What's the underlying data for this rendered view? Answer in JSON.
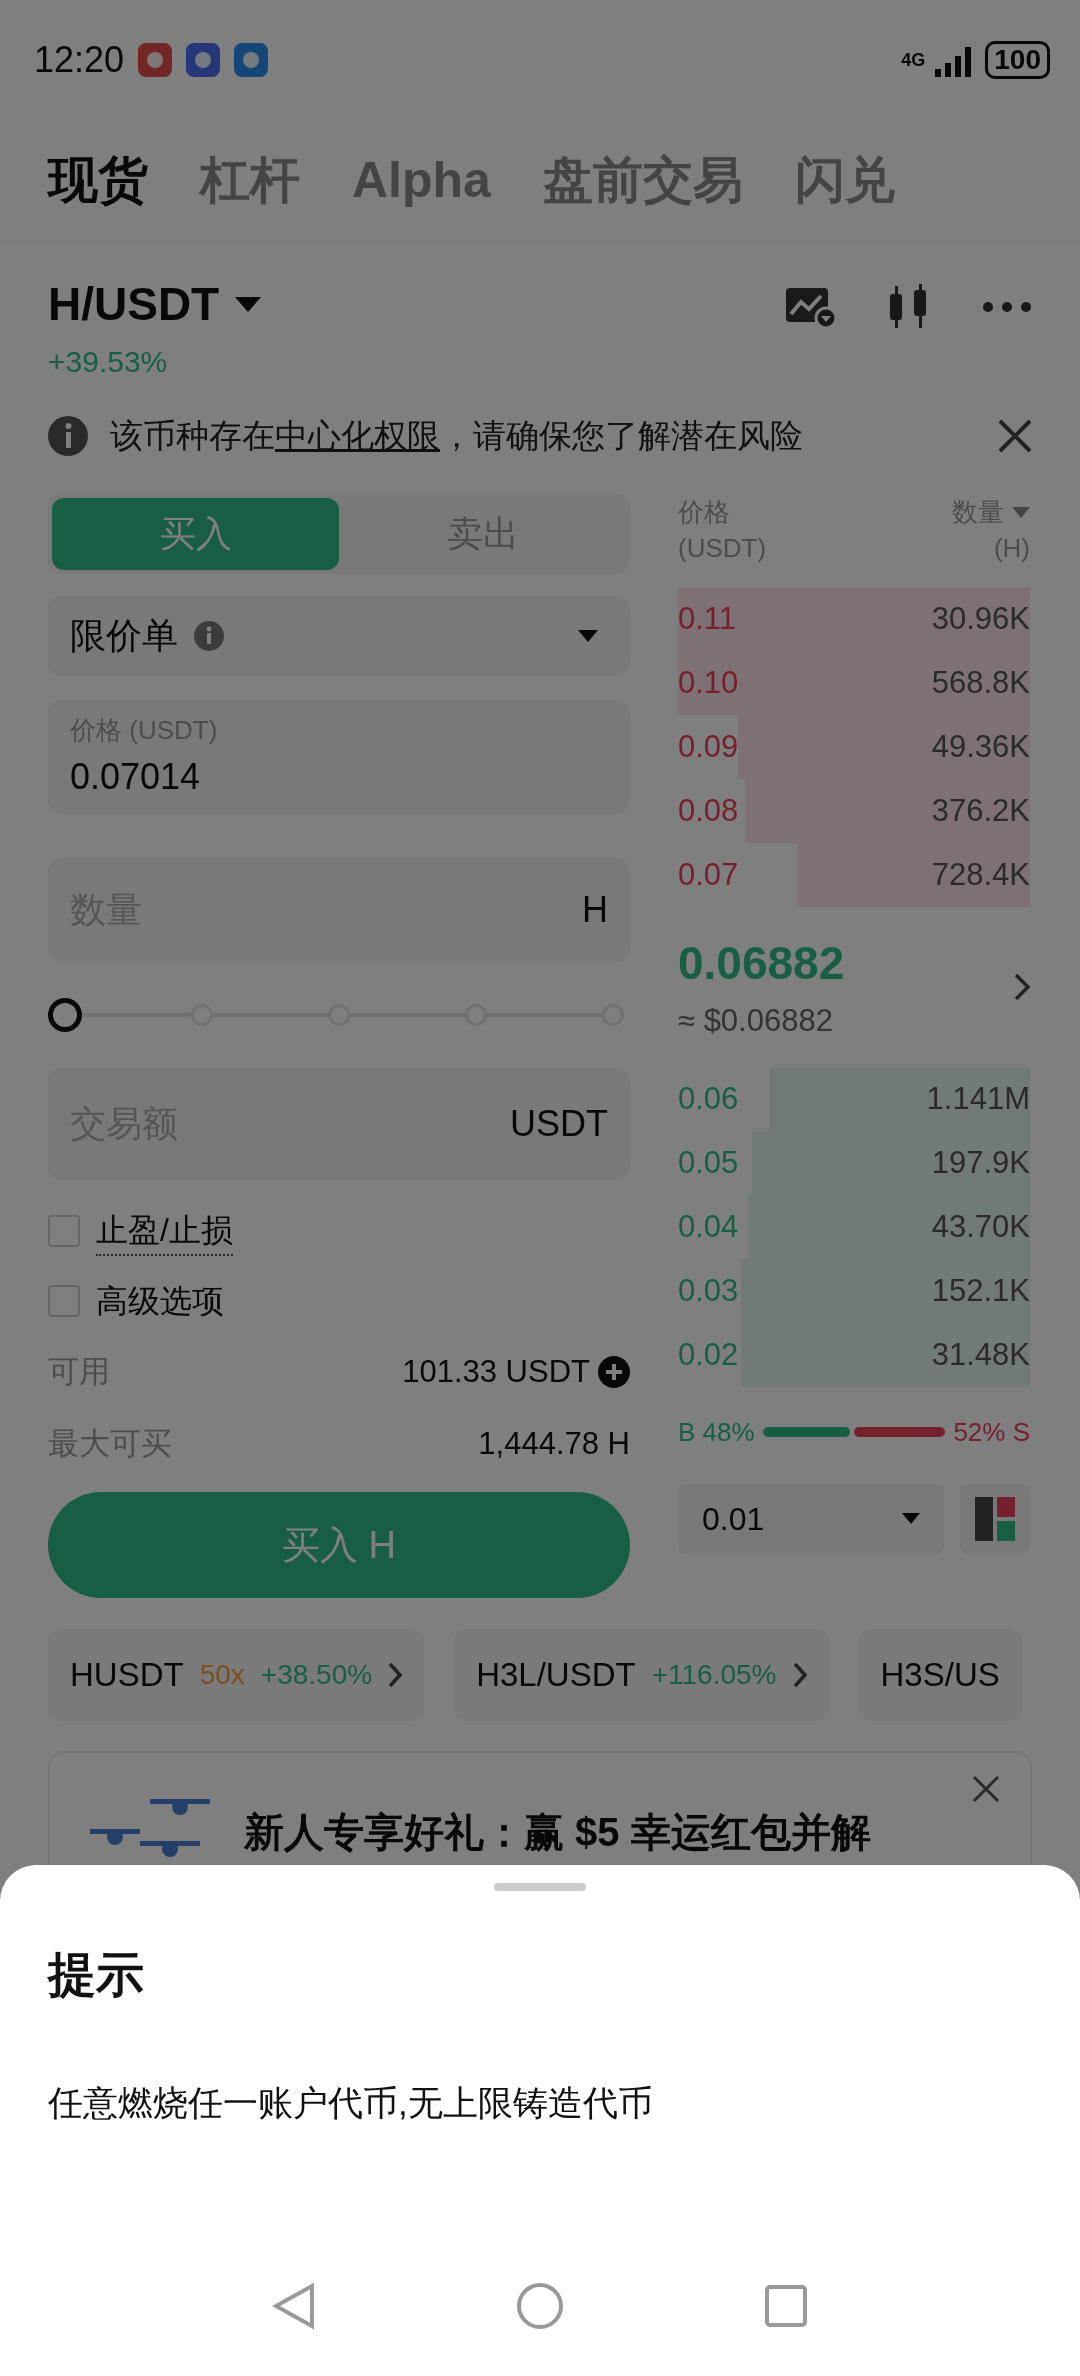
{
  "status_bar": {
    "time": "12:20",
    "network": "4G",
    "battery": "100"
  },
  "tabs": [
    {
      "label": "现货",
      "selected": true
    },
    {
      "label": "杠杆",
      "selected": false
    },
    {
      "label": "Alpha",
      "selected": false
    },
    {
      "label": "盘前交易",
      "selected": false
    },
    {
      "label": "闪兑",
      "selected": false
    }
  ],
  "pair": {
    "symbol": "H/USDT",
    "change": "+39.53%"
  },
  "notice": {
    "before": "该币种存在",
    "link": "中心化权限",
    "after": "，请确保您了解潜在风险"
  },
  "order_form": {
    "sides": [
      {
        "label": "买入",
        "selected": true
      },
      {
        "label": "卖出",
        "selected": false
      }
    ],
    "order_type": "限价单",
    "price": {
      "label": "价格 (USDT)",
      "value": "0.07014"
    },
    "amount": {
      "placeholder": "数量",
      "unit": "H"
    },
    "slider": {
      "level": 0
    },
    "total": {
      "placeholder": "交易额",
      "unit": "USDT"
    },
    "options": [
      {
        "label": "止盈/止损",
        "checked": false,
        "kind": "tooltip"
      },
      {
        "label": "高级选项",
        "checked": false,
        "kind": "plain"
      }
    ],
    "balances": [
      {
        "label": "可用",
        "value": "101.33 USDT",
        "kind": "deposit"
      },
      {
        "label": "最大可买",
        "value": "1,444.78 H",
        "kind": "plain"
      }
    ],
    "submit": "买入 H"
  },
  "order_book": {
    "headers": [
      {
        "label": "价格",
        "sub": "(USDT)",
        "kind": "plain"
      },
      {
        "label": "数量",
        "sub": "(H)",
        "kind": "dropdown"
      }
    ],
    "asks": [
      {
        "price": "0.11",
        "amount": "30.96K"
      },
      {
        "price": "0.10",
        "amount": "568.8K"
      },
      {
        "price": "0.09",
        "amount": "49.36K"
      },
      {
        "price": "0.08",
        "amount": "376.2K"
      },
      {
        "price": "0.07",
        "amount": "728.4K"
      }
    ],
    "last_price": "0.06882",
    "fiat_price": "≈ $0.06882",
    "bids": [
      {
        "price": "0.06",
        "amount": "1.141M"
      },
      {
        "price": "0.05",
        "amount": "197.9K"
      },
      {
        "price": "0.04",
        "amount": "43.70K"
      },
      {
        "price": "0.03",
        "amount": "152.1K"
      },
      {
        "price": "0.02",
        "amount": "31.48K"
      }
    ],
    "ratio": {
      "buy": "B 48%",
      "sell": "52% S"
    },
    "precision": "0.01"
  },
  "related": [
    {
      "symbol": "HUSDT",
      "leverage": "50x",
      "change": "+38.50%"
    },
    {
      "symbol": "H3L/USDT",
      "change": "+116.05%"
    },
    {
      "symbol": "H3S/US"
    }
  ],
  "promo": {
    "text": "新人专享好礼：赢 $5 幸运红包并解"
  },
  "sheet": {
    "title": "提示",
    "message": "任意燃烧任一账户代币,无上限铸造代币"
  }
}
